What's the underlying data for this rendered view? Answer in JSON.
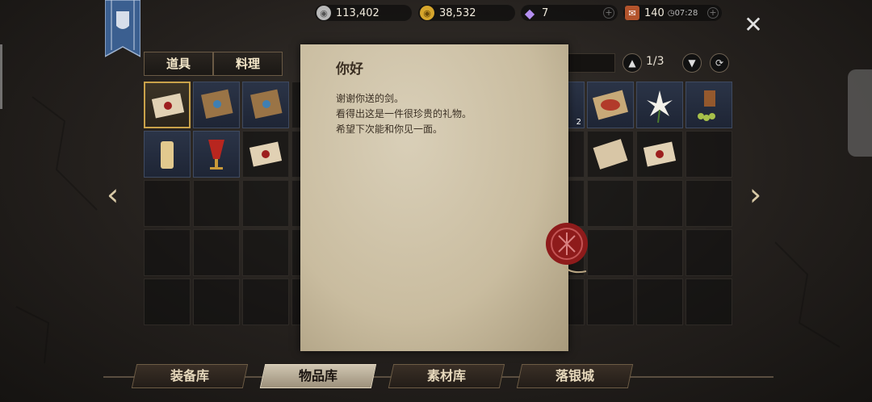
{
  "currency": {
    "silver": "113,402",
    "gold": "38,532",
    "gem": "7",
    "stamina": "140",
    "stamina_timer": "07:28"
  },
  "tabs": [
    "道具",
    "料理"
  ],
  "pagination": "1/3",
  "letter": {
    "title": "你好",
    "lines": [
      "谢谢你送的剑。",
      "看得出这是一件很珍贵的礼物。",
      "希望下次能和你见一面。"
    ]
  },
  "item_qty": "2",
  "bottom_nav": [
    "装备库",
    "物品库",
    "素材库",
    "落银城"
  ],
  "colors": {
    "accent_gold": "#c9a24a",
    "seal_red": "#8e1b1b",
    "paper": "#d9cfb8"
  }
}
